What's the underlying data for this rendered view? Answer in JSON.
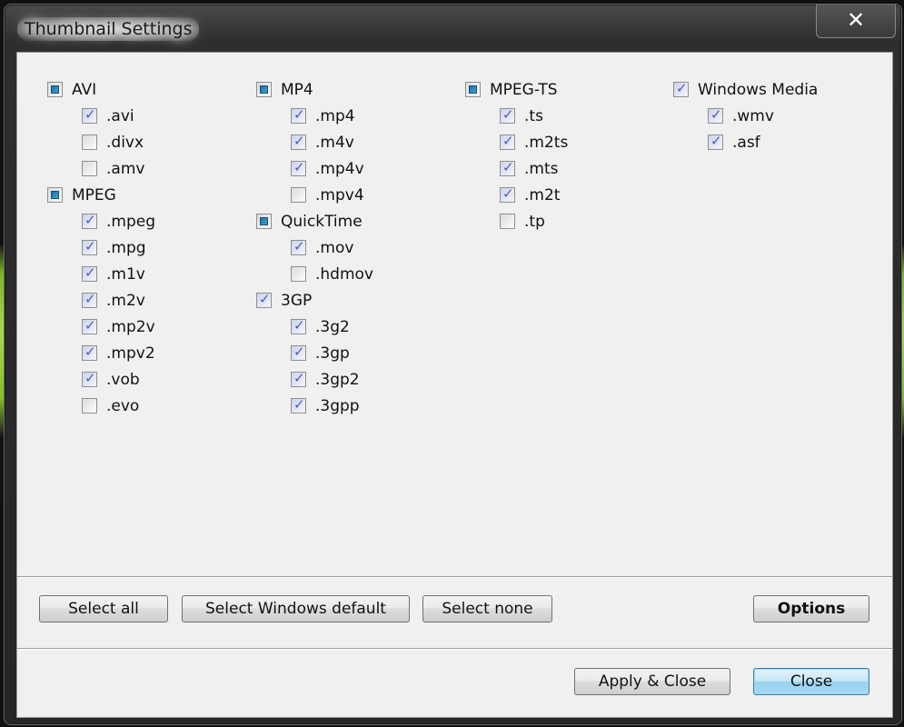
{
  "window": {
    "title": "Thumbnail Settings",
    "close_glyph": "✕"
  },
  "columns": [
    {
      "groups": [
        {
          "label": "AVI",
          "state": "partial",
          "items": [
            {
              "label": ".avi",
              "checked": true
            },
            {
              "label": ".divx",
              "checked": false
            },
            {
              "label": ".amv",
              "checked": false
            }
          ]
        },
        {
          "label": "MPEG",
          "state": "partial",
          "items": [
            {
              "label": ".mpeg",
              "checked": true
            },
            {
              "label": ".mpg",
              "checked": true
            },
            {
              "label": ".m1v",
              "checked": true
            },
            {
              "label": ".m2v",
              "checked": true
            },
            {
              "label": ".mp2v",
              "checked": true
            },
            {
              "label": ".mpv2",
              "checked": true
            },
            {
              "label": ".vob",
              "checked": true
            },
            {
              "label": ".evo",
              "checked": false
            }
          ]
        }
      ]
    },
    {
      "groups": [
        {
          "label": "MP4",
          "state": "partial",
          "items": [
            {
              "label": ".mp4",
              "checked": true
            },
            {
              "label": ".m4v",
              "checked": true
            },
            {
              "label": ".mp4v",
              "checked": true
            },
            {
              "label": ".mpv4",
              "checked": false
            }
          ]
        },
        {
          "label": "QuickTime",
          "state": "partial",
          "items": [
            {
              "label": ".mov",
              "checked": true
            },
            {
              "label": ".hdmov",
              "checked": false
            }
          ]
        },
        {
          "label": "3GP",
          "state": "checked",
          "items": [
            {
              "label": ".3g2",
              "checked": true
            },
            {
              "label": ".3gp",
              "checked": true
            },
            {
              "label": ".3gp2",
              "checked": true
            },
            {
              "label": ".3gpp",
              "checked": true
            }
          ]
        }
      ]
    },
    {
      "groups": [
        {
          "label": "MPEG-TS",
          "state": "partial",
          "items": [
            {
              "label": ".ts",
              "checked": true
            },
            {
              "label": ".m2ts",
              "checked": true
            },
            {
              "label": ".mts",
              "checked": true
            },
            {
              "label": ".m2t",
              "checked": true
            },
            {
              "label": ".tp",
              "checked": false
            }
          ]
        }
      ]
    },
    {
      "groups": [
        {
          "label": "Windows Media",
          "state": "checked",
          "items": [
            {
              "label": ".wmv",
              "checked": true
            },
            {
              "label": ".asf",
              "checked": true
            }
          ]
        }
      ]
    }
  ],
  "buttons": {
    "select_all": "Select all",
    "select_windows_default": "Select Windows default",
    "select_none": "Select none",
    "options": "Options",
    "apply_close": "Apply & Close",
    "close": "Close"
  }
}
